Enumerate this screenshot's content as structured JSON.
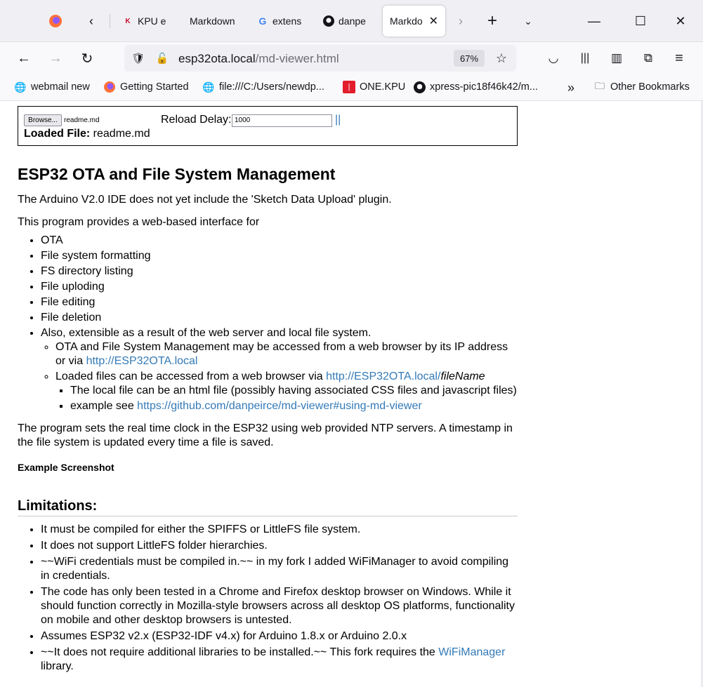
{
  "browser": {
    "tabs": [
      {
        "label": "KPU e",
        "icon": "kpu-icon"
      },
      {
        "label": "Markdown",
        "icon": ""
      },
      {
        "label": "extens",
        "icon": "google-icon"
      },
      {
        "label": "danpe",
        "icon": "github-icon"
      },
      {
        "label": "Markdo",
        "icon": "",
        "active": true
      }
    ],
    "url": {
      "host": "esp32ota.local",
      "path": "/md-viewer.html"
    },
    "zoom": "67%",
    "bookmarks": [
      {
        "label": "webmail new",
        "icon": "globe-icon"
      },
      {
        "label": "Getting Started",
        "icon": "firefox-icon"
      },
      {
        "label": "file:///C:/Users/newdp...",
        "icon": "globe-icon"
      },
      {
        "label": "ONE.KPU",
        "icon": "kpu-red-icon"
      },
      {
        "label": "xpress-pic18f46k42/m...",
        "icon": "github-icon"
      }
    ],
    "other_bookmarks": "Other Bookmarks",
    "accent_color": "#337ab7"
  },
  "controls": {
    "browse_label": "Browse...",
    "selected_file": "readme.md",
    "reload_label": "Reload Delay:",
    "reload_value": "1000",
    "pause_label": "||",
    "loaded_label": "Loaded File:",
    "loaded_value": " readme.md"
  },
  "doc": {
    "title": "ESP32 OTA and File System Management",
    "intro1": "The Arduino V2.0 IDE does not yet include the 'Sketch Data Upload' plugin.",
    "intro2": "This program provides a web-based interface for",
    "features": [
      "OTA",
      "File system formatting",
      "FS directory listing",
      "File uploding",
      "File editing",
      "File deletion"
    ],
    "extensible": "Also, extensible as a result of the web server and local file system.",
    "sub1_text": "OTA and File System Management may be accessed from a web browser by its IP address or via ",
    "sub1_link": "http://ESP32OTA.local",
    "sub2_text": "Loaded files can be accessed from a web browser via ",
    "sub2_link": "http://ESP32OTA.local/",
    "sub2_italic": "fileName",
    "sub3_1": "The local file can be an html file (possibly having associated CSS files and javascript files)",
    "sub3_2_text": "example see ",
    "sub3_2_link": "https://github.com/danpeirce/md-viewer#using-md-viewer",
    "ntp": "The program sets the real time clock in the ESP32 using web provided NTP servers. A timestamp in the file system is updated every time a file is saved.",
    "screenshot_heading": "Example Screenshot",
    "limitations_heading": "Limitations:",
    "lim1": "It must be compiled for either the SPIFFS or LittleFS file system.",
    "lim2": "It does not support LittleFS folder hierarchies.",
    "lim3": "~~WiFi credentials must be compiled in.~~ in my fork I added WiFiManager to avoid compiling in credentials.",
    "lim4": "The code has only been tested in a Chrome and Firefox desktop browser on Windows. While it should function correctly in Mozilla-style browsers across all desktop OS platforms, functionality on mobile and other desktop browsers is untested.",
    "lim5": "Assumes ESP32 v2.x (ESP32-IDF v4.x) for Arduino 1.8.x or Arduino 2.0.x",
    "lim6_text": "~~It does not require additional libraries to be installed.~~ This fork requires the ",
    "lim6_link": "WiFiManager",
    "lim6_tail": " library."
  }
}
